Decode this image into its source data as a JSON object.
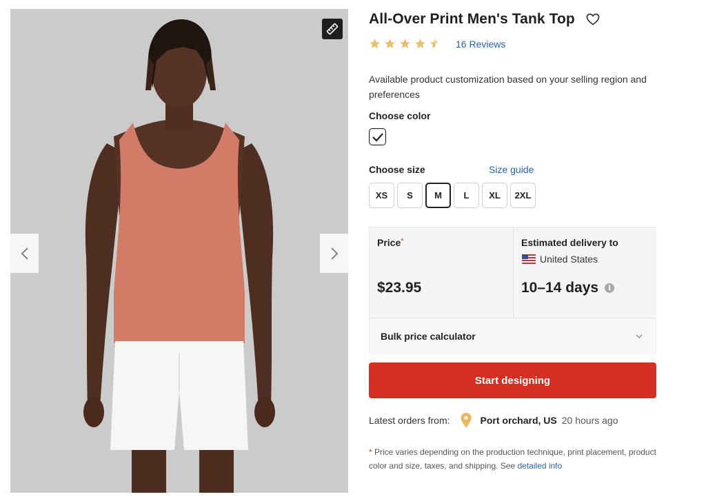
{
  "product": {
    "title": "All-Over Print Men's Tank Top",
    "rating": 4.5,
    "reviews_label": "16 Reviews",
    "description": "Available product customization based on your selling region and preferences"
  },
  "color": {
    "label": "Choose color",
    "selected": "white"
  },
  "size": {
    "label": "Choose size",
    "guide_label": "Size guide",
    "options": [
      "XS",
      "S",
      "M",
      "L",
      "XL",
      "2XL"
    ],
    "selected": "M"
  },
  "price": {
    "label": "Price",
    "asterisk": "*",
    "value": "$23.95"
  },
  "delivery": {
    "label": "Estimated delivery to",
    "country": "United States",
    "days": "10–14 days",
    "info_glyph": "i"
  },
  "bulk": {
    "label": "Bulk price calculator"
  },
  "cta": {
    "label": "Start designing",
    "color": "#d62e20"
  },
  "orders": {
    "label": "Latest orders from:",
    "city": "Port orchard, US",
    "time": "20 hours ago"
  },
  "footnote": {
    "asterisk": "*",
    "text": " Price varies depending on the production technique, print placement, product color and size, taxes, and shipping. See ",
    "link": "detailed info"
  },
  "icons": {
    "ruler": "ruler-icon",
    "prev": "chevron-left-icon",
    "next": "chevron-right-icon",
    "heart": "heart-icon",
    "pin": "location-pin-icon",
    "chevron_down": "chevron-down-icon",
    "check": "check-icon",
    "flag": "us-flag-icon"
  }
}
